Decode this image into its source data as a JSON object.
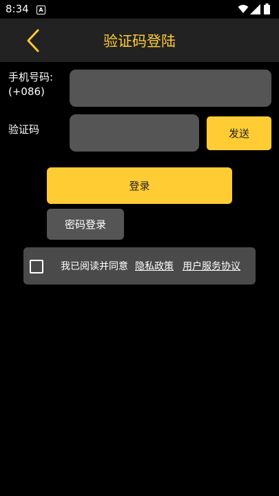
{
  "status_bar": {
    "time": "8:34",
    "notification_glyph": "A"
  },
  "header": {
    "title": "验证码登陆"
  },
  "phone": {
    "label_line1": "手机号码:",
    "label_line2": "(+086)",
    "value": ""
  },
  "code": {
    "label": "验证码",
    "value": "",
    "send_label": "发送"
  },
  "login_label": "登录",
  "password_login_label": "密码登录",
  "agreement": {
    "checked": false,
    "text": "我已阅读并同意",
    "privacy_link": "隐私政策",
    "service_link": "用户服务协议"
  },
  "colors": {
    "accent": "#ffcc33",
    "header_bg": "#222222",
    "input_bg": "#555555",
    "background": "#000000"
  }
}
